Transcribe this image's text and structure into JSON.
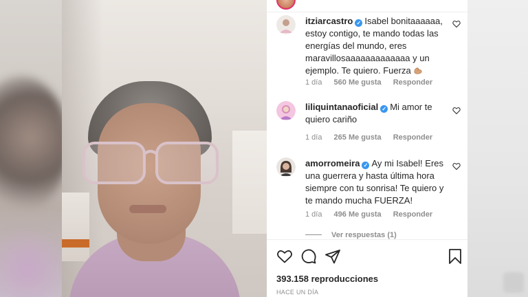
{
  "comments": [
    {
      "username": "itziarcastro",
      "verified": true,
      "text": "Isabel bonitaaaaaa, estoy contigo, te mando todas las energías del mundo, eres maravillosaaaaaaaaaaaaa y un ejemplo. Te quiero. Fuerza",
      "emoji": "flexed-biceps-icon",
      "time": "1 día",
      "likes": "560 Me gusta",
      "reply": "Responder"
    },
    {
      "username": "liliquintanaoficial",
      "verified": true,
      "text": "Mi amor te quiero cariño",
      "time": "1 día",
      "likes": "265 Me gusta",
      "reply": "Responder"
    },
    {
      "username": "amorromeira",
      "verified": true,
      "text": "Ay mi Isabel! Eres una guerrera y hasta última hora siempre con tu sonrisa! Te quiero y te mando mucha FUERZA!",
      "time": "1 día",
      "likes": "496 Me gusta",
      "reply": "Responder"
    }
  ],
  "view_replies": "Ver respuestas (1)",
  "views": "393.158 reproducciones",
  "time_ago": "HACE UN DÍA",
  "icons": {
    "like": "heart-icon",
    "comment": "comment-icon",
    "share": "paper-plane-icon",
    "save": "bookmark-icon"
  },
  "colors": {
    "verified": "#3897f0",
    "text": "#262626",
    "muted": "#8e8e8e"
  }
}
